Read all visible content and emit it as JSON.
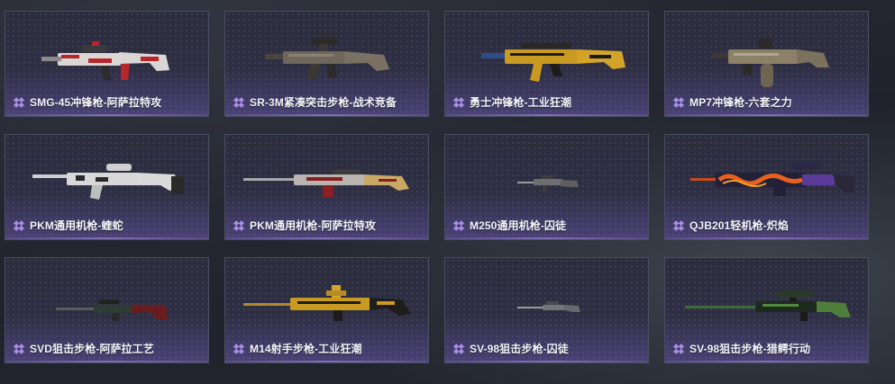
{
  "colors": {
    "rarity_purple": "#a98ee6",
    "card_border": "#4b4e63",
    "label_text": "#f4f4f8"
  },
  "items": [
    {
      "name": "SMG-45冲锋枪-阿萨拉特攻",
      "icon": "diamond-rarity-icon",
      "skin": "white-red"
    },
    {
      "name": "SR-3M紧凑突击步枪-战术竞备",
      "icon": "diamond-rarity-icon",
      "skin": "tan-camo"
    },
    {
      "name": "勇士冲锋枪-工业狂潮",
      "icon": "diamond-rarity-icon",
      "skin": "gold-black"
    },
    {
      "name": "MP7冲锋枪-六套之力",
      "icon": "diamond-rarity-icon",
      "skin": "sand-dark"
    },
    {
      "name": "PKM通用机枪-蝰蛇",
      "icon": "diamond-rarity-icon",
      "skin": "white-black"
    },
    {
      "name": "PKM通用机枪-阿萨拉特攻",
      "icon": "diamond-rarity-icon",
      "skin": "grey-red"
    },
    {
      "name": "M250通用机枪-囚徒",
      "icon": "diamond-rarity-icon",
      "skin": "grey"
    },
    {
      "name": "QJB201轻机枪-炽焰",
      "icon": "diamond-rarity-icon",
      "skin": "flame-purple"
    },
    {
      "name": "SVD狙击步枪-阿萨拉工艺",
      "icon": "diamond-rarity-icon",
      "skin": "dark-red"
    },
    {
      "name": "M14射手步枪-工业狂潮",
      "icon": "diamond-rarity-icon",
      "skin": "gold-black"
    },
    {
      "name": "SV-98狙击步枪-囚徒",
      "icon": "diamond-rarity-icon",
      "skin": "grey"
    },
    {
      "name": "SV-98狙击步枪-猎鳄行动",
      "icon": "diamond-rarity-icon",
      "skin": "green-black"
    }
  ]
}
